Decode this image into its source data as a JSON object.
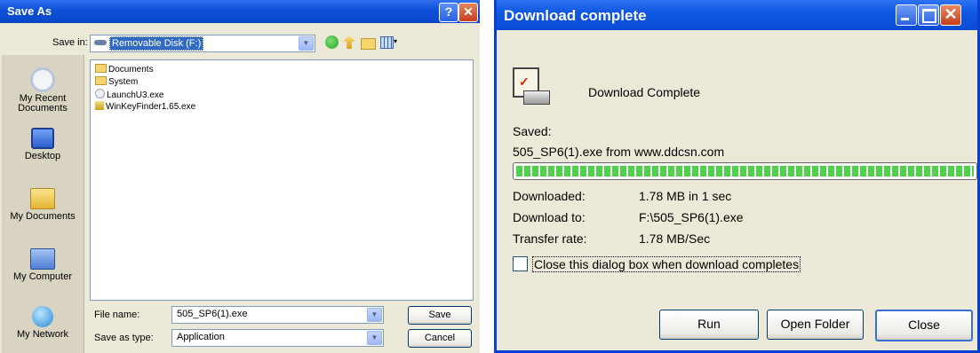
{
  "save_as": {
    "title": "Save As",
    "help_glyph": "?",
    "close_glyph": "✕",
    "save_in_label": "Save in:",
    "save_in_value": "Removable Disk (F:)",
    "places": [
      {
        "label": "My Recent Documents",
        "icon": "recent-documents-icon"
      },
      {
        "label": "Desktop",
        "icon": "desktop-icon"
      },
      {
        "label": "My Documents",
        "icon": "my-documents-icon"
      },
      {
        "label": "My Computer",
        "icon": "my-computer-icon"
      },
      {
        "label": "My Network",
        "icon": "my-network-icon"
      }
    ],
    "files": [
      {
        "name": "Documents",
        "icon": "folder-icon"
      },
      {
        "name": "System",
        "icon": "folder-icon"
      },
      {
        "name": "LaunchU3.exe",
        "icon": "exe-icon"
      },
      {
        "name": "WinKeyFinder1.65.exe",
        "icon": "key-icon"
      }
    ],
    "file_name_label": "File name:",
    "file_name_value": "505_SP6(1).exe",
    "save_as_type_label": "Save as type:",
    "save_as_type_value": "Application",
    "save_button": "Save",
    "cancel_button": "Cancel"
  },
  "download": {
    "title": "Download complete",
    "close_glyph": "✕",
    "heading": "Download Complete",
    "saved_label": "Saved:",
    "saved_value": "505_SP6(1).exe from www.ddcsn.com",
    "progress": 1.0,
    "downloaded_label": "Downloaded:",
    "downloaded_value": "1.78 MB in 1 sec",
    "download_to_label": "Download to:",
    "download_to_value": "F:\\505_SP6(1).exe",
    "transfer_rate_label": "Transfer rate:",
    "transfer_rate_value": "1.78 MB/Sec",
    "close_checkbox_label": "Close this dialog box when download completes",
    "close_checkbox_checked": false,
    "run_button": "Run",
    "open_folder_button": "Open Folder",
    "close_button": "Close"
  },
  "colors": {
    "title_blue": "#0a4cd4",
    "dialog_face": "#ece9d8",
    "progress_green": "#4dd24a"
  }
}
